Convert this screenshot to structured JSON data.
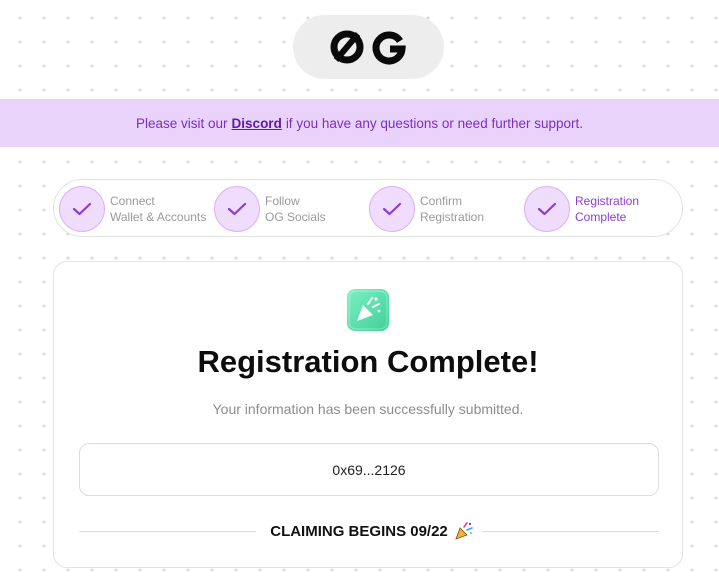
{
  "logo": {
    "text": "OG"
  },
  "banner": {
    "prefix": "Please visit our",
    "link": "Discord",
    "suffix": "if you have any questions or need further support."
  },
  "steps": [
    {
      "line1": "Connect",
      "line2": "Wallet & Accounts",
      "state": "done"
    },
    {
      "line1": "Follow",
      "line2": "OG Socials",
      "state": "done"
    },
    {
      "line1": "Confirm",
      "line2": "Registration",
      "state": "done"
    },
    {
      "line1": "Registration",
      "line2": "Complete",
      "state": "active"
    }
  ],
  "card": {
    "title": "Registration Complete!",
    "subtitle": "Your information has been successfully submitted.",
    "address": "0x69...2126",
    "claim": "CLAIMING BEGINS 09/22"
  },
  "colors": {
    "accent": "#8a3fd0",
    "banner_bg": "#ead3fb",
    "icon_green": "#4fdca8"
  }
}
